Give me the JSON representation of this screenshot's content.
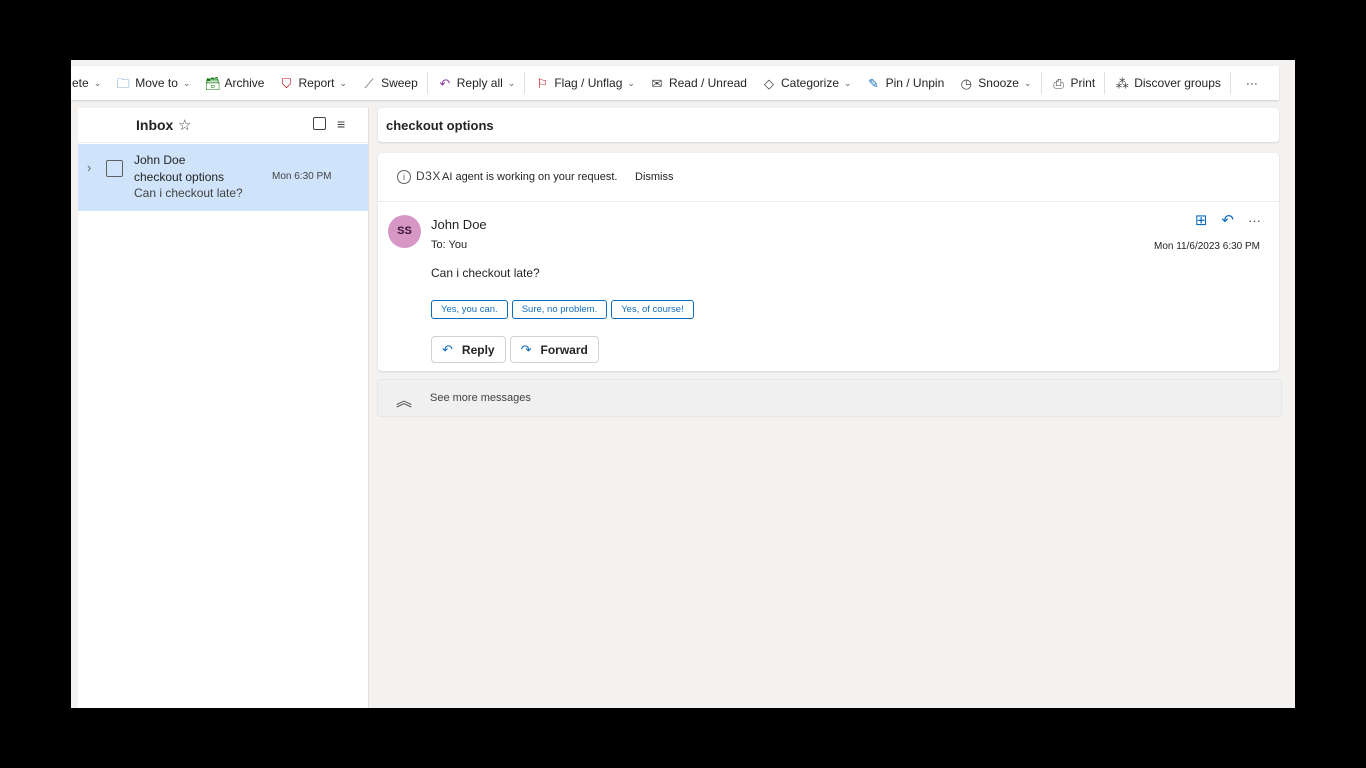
{
  "toolbar": {
    "items": [
      {
        "label": "ete",
        "icon": "delete-icon"
      },
      {
        "label": "Move to",
        "icon": "folder-move-icon"
      },
      {
        "label": "Archive",
        "icon": "archive-icon"
      },
      {
        "label": "Report",
        "icon": "shield-icon"
      },
      {
        "label": "Sweep",
        "icon": "broom-icon"
      },
      {
        "label": "Reply all",
        "icon": "reply-all-icon"
      },
      {
        "label": "Flag / Unflag",
        "icon": "flag-icon"
      },
      {
        "label": "Read / Unread",
        "icon": "envelope-open-icon"
      },
      {
        "label": "Categorize",
        "icon": "tag-icon"
      },
      {
        "label": "Pin / Unpin",
        "icon": "pin-icon"
      },
      {
        "label": "Snooze",
        "icon": "clock-icon"
      },
      {
        "label": "Print",
        "icon": "printer-icon"
      },
      {
        "label": "Discover groups",
        "icon": "groups-icon"
      },
      {
        "label": "···",
        "icon": "more-icon"
      }
    ]
  },
  "list": {
    "folder": "Inbox",
    "items": [
      {
        "sender": "John Doe",
        "subject": "checkout options",
        "preview": "Can i checkout late?",
        "time": "Mon 6:30 PM"
      }
    ]
  },
  "reading": {
    "subject": "checkout options",
    "notice": {
      "brand": "D3X",
      "text": "AI agent is working on your request.",
      "dismiss": "Dismiss"
    },
    "message": {
      "avatar": "SS",
      "from": "John Doe",
      "to": "To:  You",
      "date": "Mon 11/6/2023 6:30 PM",
      "body": "Can i checkout late?",
      "quick_replies": [
        "Yes, you can.",
        "Sure, no problem.",
        "Yes, of course!"
      ],
      "reply": "Reply",
      "forward": "Forward"
    },
    "see_more": "See more messages"
  },
  "colors": {
    "accent": "#0f6cbd",
    "selected_row": "#cfe4fa",
    "avatar": "#d696c6"
  }
}
